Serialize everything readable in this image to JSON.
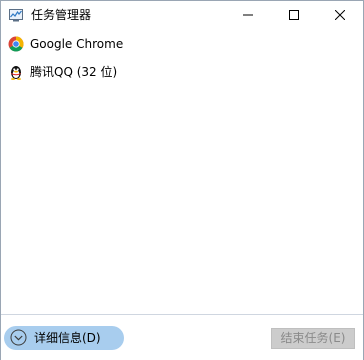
{
  "window": {
    "title": "任务管理器",
    "icon": "task-manager-icon",
    "controls": {
      "minimize": "minimize-icon",
      "maximize": "maximize-icon",
      "close": "close-icon"
    }
  },
  "apps": [
    {
      "label": "Google Chrome",
      "icon": "chrome-icon"
    },
    {
      "label": "腾讯QQ (32 位)",
      "icon": "qq-penguin-icon"
    }
  ],
  "footer": {
    "details_label": "详细信息(D)",
    "end_task_label": "结束任务(E)",
    "end_task_enabled": false,
    "details_color": "#a8cdee"
  }
}
